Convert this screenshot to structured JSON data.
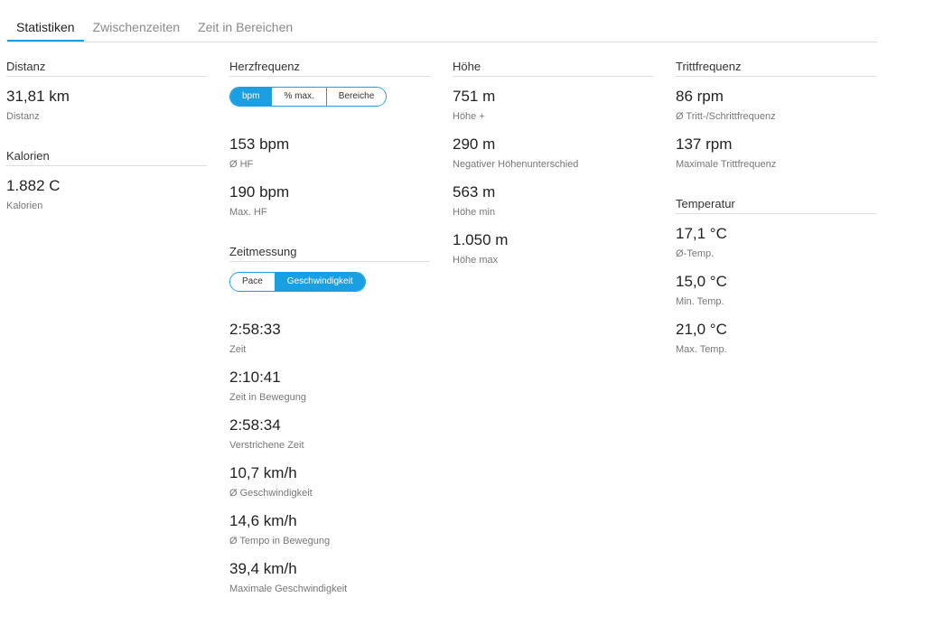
{
  "tabs": [
    "Statistiken",
    "Zwischenzeiten",
    "Zeit in Bereichen"
  ],
  "accent_color": "#1a9fe3",
  "col1": {
    "distance": {
      "title": "Distanz",
      "stats": [
        {
          "value": "31,81 km",
          "label": "Distanz"
        }
      ]
    },
    "calories": {
      "title": "Kalorien",
      "stats": [
        {
          "value": "1.882 C",
          "label": "Kalorien"
        }
      ]
    }
  },
  "col2": {
    "hr": {
      "title": "Herzfrequenz",
      "toggle": [
        "bpm",
        "% max.",
        "Bereiche"
      ],
      "selected": "bpm",
      "stats": [
        {
          "value": "153 bpm",
          "label": "Ø HF"
        },
        {
          "value": "190 bpm",
          "label": "Max. HF"
        }
      ]
    },
    "timing": {
      "title": "Zeitmessung",
      "toggle": [
        "Pace",
        "Geschwindigkeit"
      ],
      "selected": "Geschwindigkeit",
      "stats": [
        {
          "value": "2:58:33",
          "label": "Zeit"
        },
        {
          "value": "2:10:41",
          "label": "Zeit in Bewegung"
        },
        {
          "value": "2:58:34",
          "label": "Verstrichene Zeit"
        },
        {
          "value": "10,7 km/h",
          "label": "Ø Geschwindigkeit"
        },
        {
          "value": "14,6 km/h",
          "label": "Ø Tempo in Bewegung"
        },
        {
          "value": "39,4 km/h",
          "label": "Maximale Geschwindigkeit"
        }
      ]
    }
  },
  "col3": {
    "elevation": {
      "title": "Höhe",
      "stats": [
        {
          "value": "751 m",
          "label": "Höhe +"
        },
        {
          "value": "290 m",
          "label": "Negativer Höhenunterschied"
        },
        {
          "value": "563 m",
          "label": "Höhe min"
        },
        {
          "value": "1.050 m",
          "label": "Höhe max"
        }
      ]
    }
  },
  "col4": {
    "cadence": {
      "title": "Trittfrequenz",
      "stats": [
        {
          "value": "86 rpm",
          "label": "Ø Tritt-/Schrittfrequenz"
        },
        {
          "value": "137 rpm",
          "label": "Maximale Trittfrequenz"
        }
      ]
    },
    "temperature": {
      "title": "Temperatur",
      "stats": [
        {
          "value": "17,1 °C",
          "label": "Ø-Temp."
        },
        {
          "value": "15,0 °C",
          "label": "Min. Temp."
        },
        {
          "value": "21,0 °C",
          "label": "Max. Temp."
        }
      ]
    }
  }
}
